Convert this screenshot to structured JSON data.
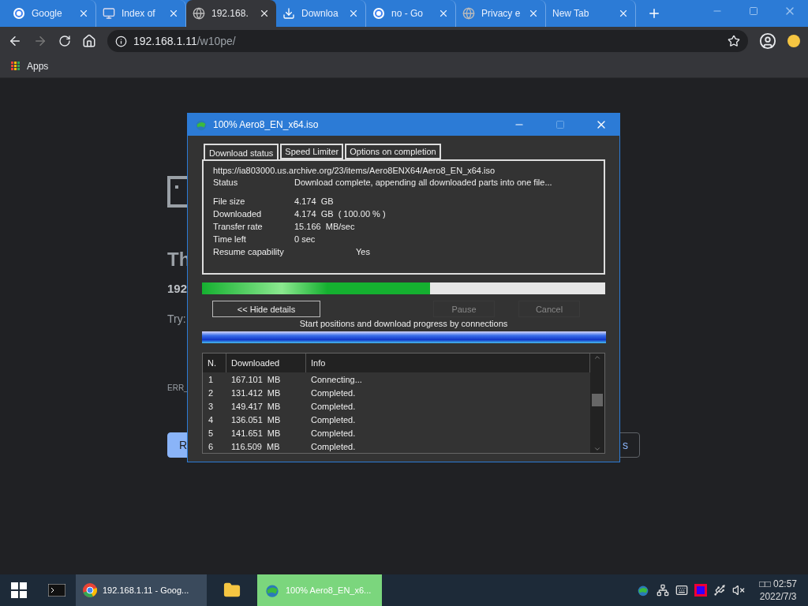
{
  "browser": {
    "tabs": [
      {
        "title": "Google",
        "selected": false
      },
      {
        "title": "Index of",
        "selected": false
      },
      {
        "title": "192.168.",
        "selected": true
      },
      {
        "title": "Downloa",
        "selected": false
      },
      {
        "title": "no - Go",
        "selected": false
      },
      {
        "title": "Privacy e",
        "selected": false
      },
      {
        "title": "New Tab",
        "selected": false
      }
    ],
    "address": {
      "host": "192.168.1.11",
      "path": "/w10pe/"
    },
    "bookmarks": [
      {
        "label": "Apps"
      }
    ]
  },
  "page": {
    "title": "Th",
    "host": "192",
    "try": "Try:",
    "error": "ERR_",
    "buttons": [
      {
        "label": "R",
        "kind": "primary"
      },
      {
        "label": "s",
        "kind": "outline"
      }
    ]
  },
  "dialog": {
    "title": "100% Aero8_EN_x64.iso",
    "tabs": [
      {
        "label": "Download status",
        "selected": true
      },
      {
        "label": "Speed Limiter",
        "selected": false
      },
      {
        "label": "Options on completion",
        "selected": false
      }
    ],
    "url": "https://ia803000.us.archive.org/23/items/Aero8ENX64/Aero8_EN_x64.iso",
    "status": {
      "label": "Status",
      "value": "Download complete, appending all downloaded parts into one file..."
    },
    "details": [
      {
        "label": "File size",
        "value": "4.174  GB"
      },
      {
        "label": "Downloaded",
        "value": "4.174  GB  ( 100.00 % )"
      },
      {
        "label": "Transfer rate",
        "value": "15.166  MB/sec"
      },
      {
        "label": "Time left",
        "value": "0 sec"
      },
      {
        "label": "Resume capability",
        "value": "Yes",
        "kind": "far"
      }
    ],
    "progress": {
      "level": 0.565
    },
    "buttons": [
      {
        "label": "<< Hide details",
        "disabled": false
      },
      {
        "label": "Pause",
        "disabled": true
      },
      {
        "label": "Cancel",
        "disabled": true
      }
    ],
    "connections_caption": "Start positions and download progress by connections",
    "table": {
      "columns": [
        "N.",
        "Downloaded",
        "Info"
      ],
      "rows": [
        [
          "1",
          "167.101  MB",
          "Connecting..."
        ],
        [
          "2",
          "131.412  MB",
          "Completed."
        ],
        [
          "3",
          "149.417  MB",
          "Completed."
        ],
        [
          "4",
          "136.051  MB",
          "Completed."
        ],
        [
          "5",
          "141.651  MB",
          "Completed."
        ],
        [
          "6",
          "116.509  MB",
          "Completed."
        ]
      ]
    }
  },
  "taskbar": {
    "items": [
      {
        "label": "192.168.1.11 - Goog...",
        "selected": false
      },
      {
        "label": "100% Aero8_EN_x6...",
        "selected": true
      }
    ],
    "clock": {
      "time": "□□ 02:57",
      "date": "2022/7/3"
    }
  }
}
